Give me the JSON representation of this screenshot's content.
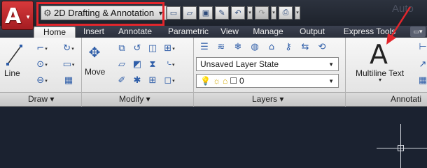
{
  "app": {
    "button_letter": "A",
    "title_fragment": "Auto"
  },
  "workspace": {
    "selected": "2D Drafting & Annotation"
  },
  "tabs": [
    {
      "label": "Home",
      "active": true
    },
    {
      "label": "Insert",
      "active": false
    },
    {
      "label": "Annotate",
      "active": false
    },
    {
      "label": "Parametric",
      "active": false
    },
    {
      "label": "View",
      "active": false
    },
    {
      "label": "Manage",
      "active": false
    },
    {
      "label": "Output",
      "active": false
    },
    {
      "label": "Express Tools",
      "active": false
    }
  ],
  "panels": {
    "draw": {
      "title": "Draw ▾",
      "line_label": "Line"
    },
    "modify": {
      "title": "Modify ▾",
      "move_label": "Move"
    },
    "layers": {
      "title": "Layers ▾",
      "layer_state": "Unsaved Layer State",
      "current_layer": "0"
    },
    "annotation": {
      "title": "Annotati",
      "mtext_label": "Multiline Text",
      "mtext_icon": "A"
    }
  },
  "colors": {
    "highlight": "#e3262c",
    "app_button": "#c62b2f",
    "ribbon_bg": "#f0f0f0",
    "drawing_bg": "#1b2230"
  }
}
